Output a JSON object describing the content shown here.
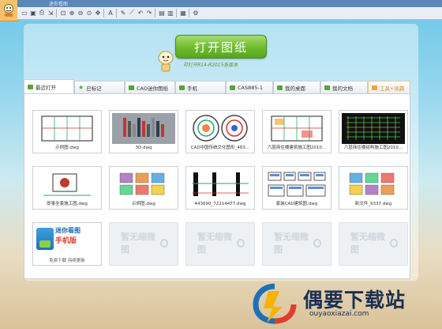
{
  "window": {
    "title": "迷你看图"
  },
  "toolbar": {
    "buttons": [
      {
        "name": "new-file-icon",
        "glyph": "▭"
      },
      {
        "name": "save-icon",
        "glyph": "▣"
      },
      {
        "name": "print-icon",
        "glyph": "⎙"
      },
      {
        "name": "export-icon",
        "glyph": "⇲"
      },
      {
        "name": "zoom-window-icon",
        "glyph": "⊡"
      },
      {
        "name": "zoom-in-icon",
        "glyph": "⊕"
      },
      {
        "name": "zoom-out-icon",
        "glyph": "⊖"
      },
      {
        "name": "zoom-extents-icon",
        "glyph": "⊙"
      },
      {
        "name": "pan-icon",
        "glyph": "✥"
      },
      {
        "name": "text-icon",
        "glyph": "A"
      },
      {
        "name": "pen-icon",
        "glyph": "✎"
      },
      {
        "name": "measure-icon",
        "glyph": "⟋"
      },
      {
        "name": "undo-icon",
        "glyph": "↶"
      },
      {
        "name": "redo-icon",
        "glyph": "↷"
      },
      {
        "name": "layers-icon",
        "glyph": "▤"
      },
      {
        "name": "layout-icon",
        "glyph": "▥"
      },
      {
        "name": "screen-icon",
        "glyph": "▦"
      },
      {
        "name": "settings-icon",
        "glyph": "⚙"
      }
    ]
  },
  "open_button": "打开图纸",
  "tagline": "可打开R14-R2015各版本",
  "tabs": [
    {
      "label": "最近打开",
      "icon": "square"
    },
    {
      "label": "已标记",
      "icon": "star"
    },
    {
      "label": "CAD迷你图纸",
      "icon": "square"
    },
    {
      "label": "手机",
      "icon": "square"
    },
    {
      "label": "CAS885-1",
      "icon": "square"
    },
    {
      "label": "我的桌面",
      "icon": "square"
    },
    {
      "label": "我的文档",
      "icon": "square"
    },
    {
      "label": "工具+插篇",
      "icon": "square"
    }
  ],
  "thumbnails": [
    {
      "caption": "示例图.dwg",
      "kind": "plan"
    },
    {
      "caption": "3D.dwg",
      "kind": "3d"
    },
    {
      "caption": "CAD中国传统文化图形_483...",
      "kind": "circle"
    },
    {
      "caption": "六层商住楼建筑施工图2010...",
      "kind": "arch"
    },
    {
      "caption": "六层商住楼结构施工图2010...",
      "kind": "struct"
    },
    {
      "caption": "即事全套施工图.dwg",
      "kind": "detail"
    },
    {
      "caption": "示例图.dwg",
      "kind": "colorplan"
    },
    {
      "caption": "443690_72214477.dwg",
      "kind": "section"
    },
    {
      "caption": "家装CAD建筑图.dwg",
      "kind": "furniture"
    },
    {
      "caption": "新文件_9337.dwg",
      "kind": "colorplan2"
    }
  ],
  "promo": {
    "line1": "迷你看图",
    "line2": "手机版",
    "footer": "免费下载   持续更新"
  },
  "empty_slot_label": "暂无缩微图",
  "watermark": {
    "text": "偶要下载站",
    "url": "ouyaoxiazai.com"
  },
  "colors": {
    "accent_green": "#6fbb2e",
    "tab_tools": "#e38b1a",
    "brand_blue": "#1a2f52"
  }
}
